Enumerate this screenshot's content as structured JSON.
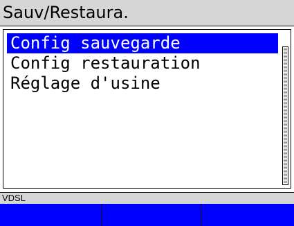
{
  "title": "Sauv/Restaura.",
  "menu": {
    "items": [
      {
        "label": "Config sauvegarde",
        "selected": true
      },
      {
        "label": "Config restauration",
        "selected": false
      },
      {
        "label": "Réglage d'usine",
        "selected": false
      }
    ]
  },
  "status": {
    "text": "VDSL"
  },
  "softkeys": [
    "",
    "",
    ""
  ],
  "colors": {
    "selection": "#0000ff",
    "softkey_bar": "#0000ff",
    "title_bar": "#d6d6d6"
  }
}
